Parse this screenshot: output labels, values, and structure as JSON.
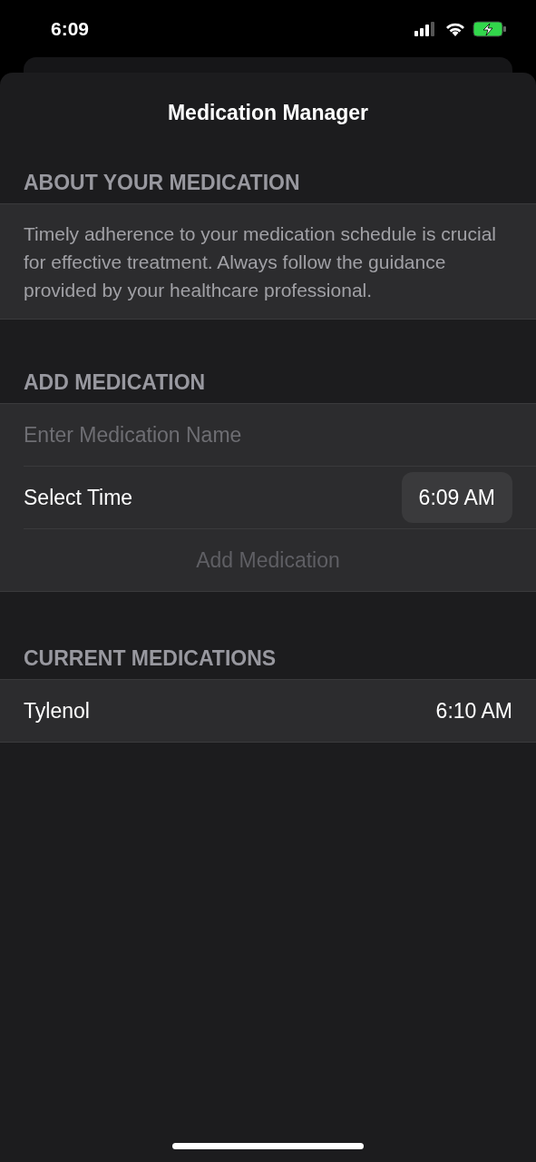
{
  "status_bar": {
    "time": "6:09"
  },
  "title": "Medication Manager",
  "about": {
    "header": "ABOUT YOUR MEDICATION",
    "text": "Timely adherence to your medication schedule is crucial for effective treatment. Always follow the guidance provided by your healthcare professional."
  },
  "add": {
    "header": "ADD MEDICATION",
    "name_field": {
      "placeholder": "Enter Medication Name"
    },
    "time_label": "Select Time",
    "time_value": "6:09 AM",
    "button": {
      "label": "Add Medication",
      "disabled": true
    }
  },
  "current": {
    "header": "CURRENT MEDICATIONS",
    "items": [
      {
        "name": "Tylenol",
        "time": "6:10 AM"
      }
    ]
  }
}
